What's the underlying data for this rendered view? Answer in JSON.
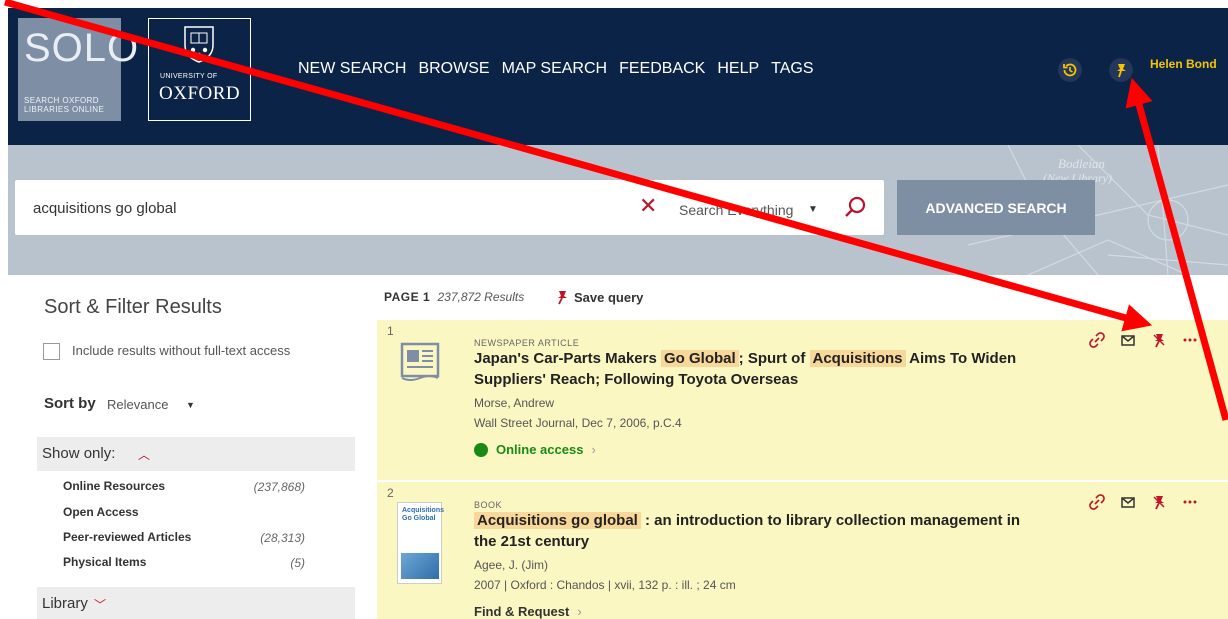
{
  "header": {
    "solo_big": "SOLO",
    "solo_small_line1": "SEARCH OXFORD",
    "solo_small_line2": "LIBRARIES ONLINE",
    "uni_small": "UNIVERSITY OF",
    "uni_big": "OXFORD",
    "nav": [
      "NEW SEARCH",
      "BROWSE",
      "MAP SEARCH",
      "FEEDBACK",
      "HELP",
      "TAGS"
    ],
    "user_name": "Helen Bond",
    "icons": [
      "history-icon",
      "pin-icon"
    ]
  },
  "search": {
    "query": "acquisitions go global",
    "scope": "Search Everything",
    "advanced_label": "ADVANCED SEARCH"
  },
  "sidebar": {
    "title": "Sort & Filter Results",
    "fulltext_label": "Include results without full-text access",
    "sort_label": "Sort by",
    "sort_value": "Relevance",
    "show_only_label": "Show only:",
    "show_only_items": [
      {
        "label": "Online Resources",
        "count": "(237,868)"
      },
      {
        "label": "Open Access",
        "count": ""
      },
      {
        "label": "Peer-reviewed Articles",
        "count": "(28,313)"
      },
      {
        "label": "Physical Items",
        "count": "(5)"
      }
    ],
    "library_label": "Library"
  },
  "results_header": {
    "page": "PAGE 1",
    "count": "237,872 Results",
    "save_query": "Save query"
  },
  "results": [
    {
      "num": "1",
      "type": "NEWSPAPER ARTICLE",
      "title_pre": "Japan's Car-Parts Makers ",
      "title_hl1": "Go Global",
      "title_mid": "; Spurt of ",
      "title_hl2": "Acquisitions",
      "title_post": " Aims To Widen Suppliers' Reach; Following Toyota Overseas",
      "author": "Morse, Andrew",
      "source": "Wall Street Journal, Dec 7, 2006, p.C.4",
      "access": "Online access",
      "access_color": "#1a8a14"
    },
    {
      "num": "2",
      "type": "BOOK",
      "title_hl1": "Acquisitions go global",
      "title_post": " : an introduction to library collection management in the 21st century",
      "author": "Agee, J. (Jim)",
      "source": "2007 | Oxford : Chandos | xvii, 132 p. : ill. ; 24 cm",
      "access": "Find & Request",
      "thumb_text": "Acquisitions Go Global"
    }
  ],
  "colors": {
    "header_bg": "#0b2346",
    "accent_red": "#c0152a",
    "user_yellow": "#f5c400",
    "result_bg": "#fbf7c2",
    "highlight": "#f8d79a",
    "annotation_arrow": "#ff0000"
  }
}
